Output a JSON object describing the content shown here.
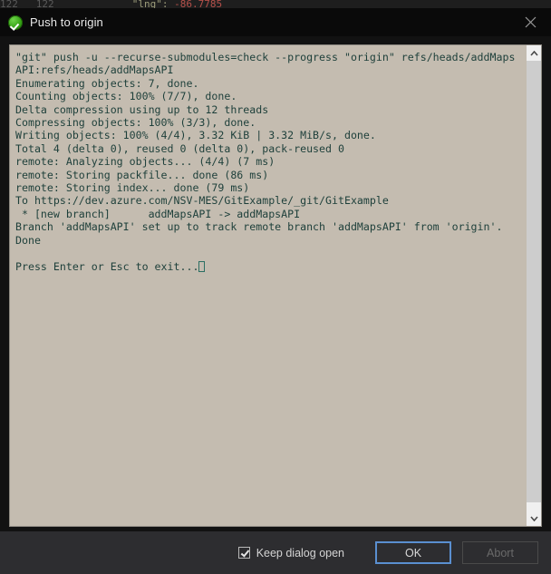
{
  "background_strip": {
    "line_number": "122",
    "gutter_number": "122",
    "key": "\"lng\":",
    "value": "-86.7785"
  },
  "dialog": {
    "title": "Push to origin",
    "status_icon": "success-check-icon",
    "close_icon": "close-icon",
    "accent_focus_color": "#5a8fd0",
    "console_bg_color": "#c4bcb0",
    "console_text_color": "#1d3f3a",
    "titlebar_bg_color": "#0a0a0a",
    "footer_bg_color": "#2d2d30"
  },
  "console": {
    "lines": [
      "\"git\" push -u --recurse-submodules=check --progress \"origin\" refs/heads/addMaps",
      "API:refs/heads/addMapsAPI",
      "Enumerating objects: 7, done.",
      "Counting objects: 100% (7/7), done.",
      "Delta compression using up to 12 threads",
      "Compressing objects: 100% (3/3), done.",
      "Writing objects: 100% (4/4), 3.32 KiB | 3.32 MiB/s, done.",
      "Total 4 (delta 0), reused 0 (delta 0), pack-reused 0",
      "remote: Analyzing objects... (4/4) (7 ms)",
      "remote: Storing packfile... done (86 ms)",
      "remote: Storing index... done (79 ms)",
      "To https://dev.azure.com/NSV-MES/GitExample/_git/GitExample",
      " * [new branch]      addMapsAPI -> addMapsAPI",
      "Branch 'addMapsAPI' set up to track remote branch 'addMapsAPI' from 'origin'.",
      "Done",
      "",
      "Press Enter or Esc to exit..."
    ]
  },
  "scrollbar": {
    "up_arrow_icon": "chevron-up-icon",
    "down_arrow_icon": "chevron-down-icon"
  },
  "footer": {
    "keep_dialog_open_label": "Keep dialog open",
    "keep_dialog_open_checked": true,
    "ok_label": "OK",
    "abort_label": "Abort",
    "abort_disabled": true
  }
}
